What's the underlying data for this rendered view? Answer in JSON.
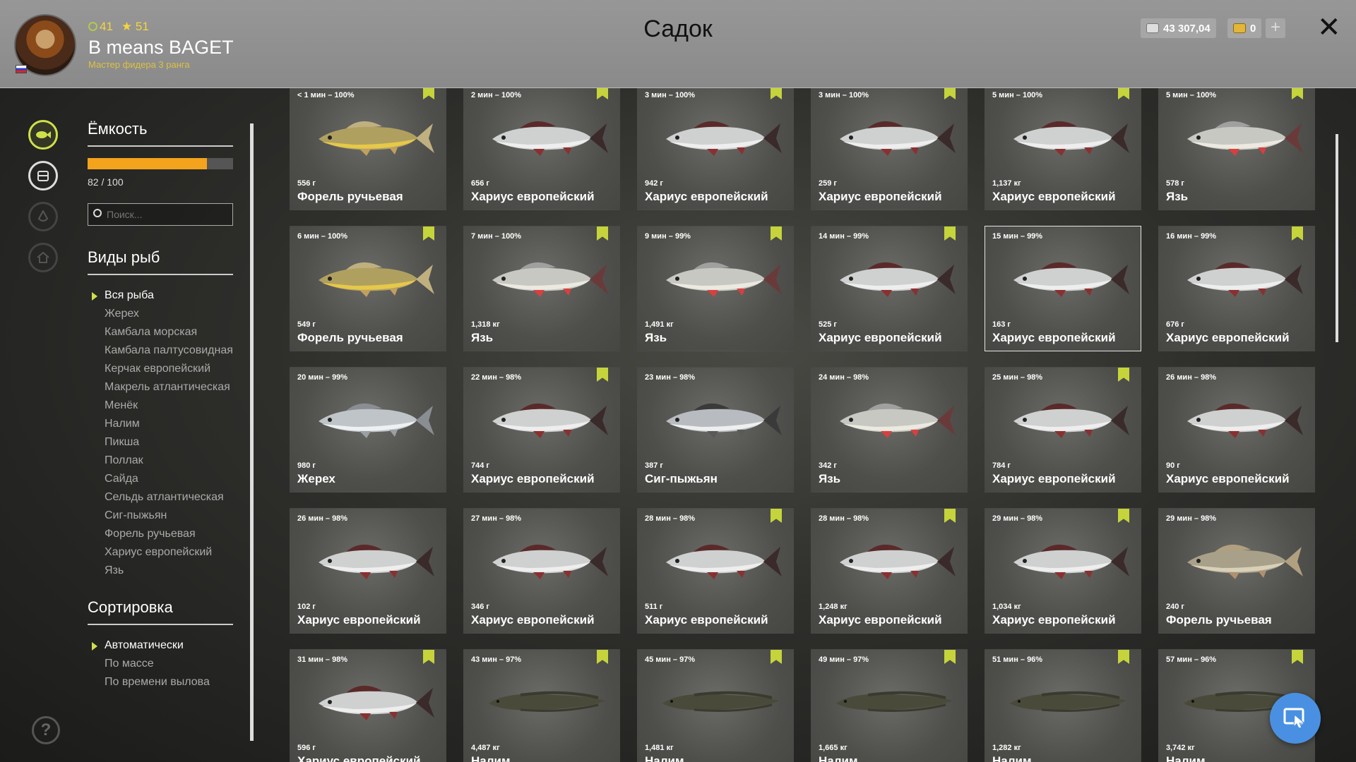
{
  "player": {
    "coins": "41",
    "stars": "51",
    "name": "B means BAGET",
    "rank": "Мастер фидера 3 ранга"
  },
  "header": {
    "title": "Садок",
    "silver": "43 307,04",
    "gold": "0",
    "plus": "+",
    "close": "✕"
  },
  "panel": {
    "capacity_title": "Ёмкость",
    "capacity_text": "82 / 100",
    "capacity_fraction": 0.82,
    "search_placeholder": "Поиск...",
    "species_title": "Виды рыб",
    "species": [
      "Вся рыба",
      "Жерех",
      "Камбала морская",
      "Камбала палтусовидная",
      "Керчак европейский",
      "Макрель атлантическая",
      "Менёк",
      "Налим",
      "Пикша",
      "Поллак",
      "Сайда",
      "Сельдь атлантическая",
      "Сиг-пыжьян",
      "Форель ручьевая",
      "Хариус европейский",
      "Язь"
    ],
    "sort_title": "Сортировка",
    "sort": [
      "Автоматически",
      "По массе",
      "По времени вылова"
    ],
    "help": "?"
  },
  "colors": {
    "accent": "#cfe04a",
    "capacity": "#f3a31c",
    "button": "#4a90e2"
  },
  "fish": [
    {
      "time": "< 1 мин – 100%",
      "weight": "556 г",
      "name": "Форель ручьевая",
      "bm": true,
      "type": "trout"
    },
    {
      "time": "2 мин – 100%",
      "weight": "656 г",
      "name": "Хариус европейский",
      "bm": true,
      "type": "grayling"
    },
    {
      "time": "3 мин – 100%",
      "weight": "942 г",
      "name": "Хариус европейский",
      "bm": true,
      "type": "grayling"
    },
    {
      "time": "3 мин – 100%",
      "weight": "259 г",
      "name": "Хариус европейский",
      "bm": true,
      "type": "grayling"
    },
    {
      "time": "5 мин – 100%",
      "weight": "1,137 кг",
      "name": "Хариус европейский",
      "bm": true,
      "type": "grayling"
    },
    {
      "time": "5 мин – 100%",
      "weight": "578 г",
      "name": "Язь",
      "bm": true,
      "type": "ide"
    },
    {
      "time": "6 мин – 100%",
      "weight": "549 г",
      "name": "Форель ручьевая",
      "bm": true,
      "type": "trout"
    },
    {
      "time": "7 мин – 100%",
      "weight": "1,318 кг",
      "name": "Язь",
      "bm": true,
      "type": "ide"
    },
    {
      "time": "9 мин – 99%",
      "weight": "1,491 кг",
      "name": "Язь",
      "bm": true,
      "type": "ide"
    },
    {
      "time": "14 мин – 99%",
      "weight": "525 г",
      "name": "Хариус европейский",
      "bm": true,
      "type": "grayling"
    },
    {
      "time": "15 мин – 99%",
      "weight": "163 г",
      "name": "Хариус европейский",
      "bm": false,
      "type": "grayling",
      "hl": true
    },
    {
      "time": "16 мин – 99%",
      "weight": "676 г",
      "name": "Хариус европейский",
      "bm": true,
      "type": "grayling"
    },
    {
      "time": "20 мин – 99%",
      "weight": "980 г",
      "name": "Жерех",
      "bm": false,
      "type": "asp"
    },
    {
      "time": "22 мин – 98%",
      "weight": "744 г",
      "name": "Хариус европейский",
      "bm": true,
      "type": "grayling"
    },
    {
      "time": "23 мин – 98%",
      "weight": "387 г",
      "name": "Сиг-пыжьян",
      "bm": false,
      "type": "whitefish"
    },
    {
      "time": "24 мин – 98%",
      "weight": "342 г",
      "name": "Язь",
      "bm": false,
      "type": "ide"
    },
    {
      "time": "25 мин – 98%",
      "weight": "784 г",
      "name": "Хариус европейский",
      "bm": true,
      "type": "grayling"
    },
    {
      "time": "26 мин – 98%",
      "weight": "90 г",
      "name": "Хариус европейский",
      "bm": false,
      "type": "grayling"
    },
    {
      "time": "26 мин – 98%",
      "weight": "102 г",
      "name": "Хариус европейский",
      "bm": false,
      "type": "grayling"
    },
    {
      "time": "27 мин – 98%",
      "weight": "346 г",
      "name": "Хариус европейский",
      "bm": false,
      "type": "grayling"
    },
    {
      "time": "28 мин – 98%",
      "weight": "511 г",
      "name": "Хариус европейский",
      "bm": true,
      "type": "grayling"
    },
    {
      "time": "28 мин – 98%",
      "weight": "1,248 кг",
      "name": "Хариус европейский",
      "bm": true,
      "type": "grayling"
    },
    {
      "time": "29 мин – 98%",
      "weight": "1,034 кг",
      "name": "Хариус европейский",
      "bm": true,
      "type": "grayling"
    },
    {
      "time": "29 мин – 98%",
      "weight": "240 г",
      "name": "Форель ручьевая",
      "bm": false,
      "type": "trout2"
    },
    {
      "time": "31 мин – 98%",
      "weight": "596 г",
      "name": "Хариус европейский",
      "bm": true,
      "type": "grayling"
    },
    {
      "time": "43 мин – 97%",
      "weight": "4,487 кг",
      "name": "Налим",
      "bm": true,
      "type": "burbot"
    },
    {
      "time": "45 мин – 97%",
      "weight": "1,481 кг",
      "name": "Налим",
      "bm": true,
      "type": "burbot"
    },
    {
      "time": "49 мин – 97%",
      "weight": "1,665 кг",
      "name": "Налим",
      "bm": true,
      "type": "burbot"
    },
    {
      "time": "51 мин – 96%",
      "weight": "1,282 кг",
      "name": "Налим",
      "bm": true,
      "type": "burbot"
    },
    {
      "time": "57 мин – 96%",
      "weight": "3,742 кг",
      "name": "Налим",
      "bm": true,
      "type": "burbot"
    }
  ]
}
